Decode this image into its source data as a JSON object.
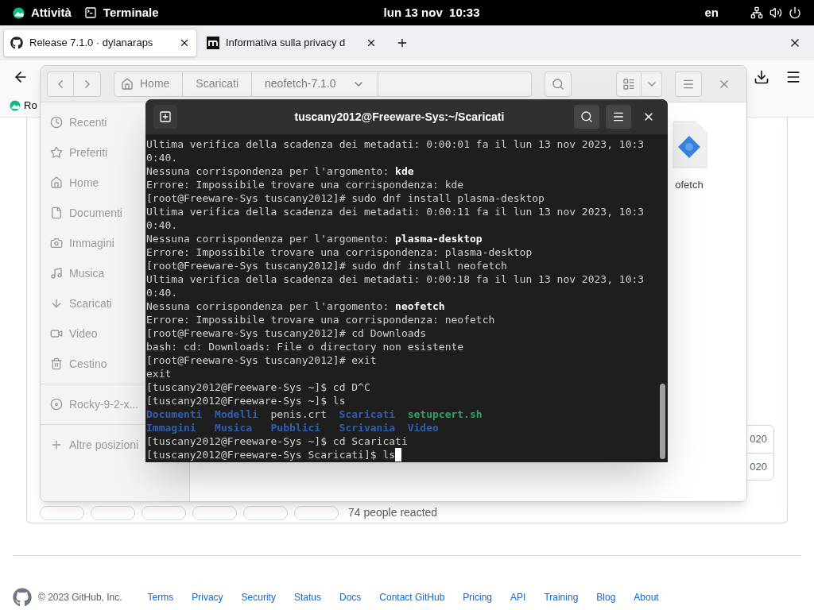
{
  "top_bar": {
    "activities": "Attività",
    "app": "Terminale",
    "clock": "lun 13 nov  10:33",
    "keyboard": "en"
  },
  "browser": {
    "tabs": [
      {
        "title": "Release 7.1.0 · dylanaraps",
        "selected": true
      },
      {
        "title": "Informativa sulla privacy d",
        "selected": false
      }
    ],
    "bookmarks": [
      "Ro"
    ],
    "page": {
      "dates": [
        "020",
        "020"
      ],
      "reactions_summary": "74 people reacted",
      "footer": {
        "copyright": "© 2023 GitHub, Inc.",
        "links": [
          "Terms",
          "Privacy",
          "Security",
          "Status",
          "Docs",
          "Contact GitHub",
          "Pricing",
          "API",
          "Training",
          "Blog",
          "About"
        ]
      }
    }
  },
  "files": {
    "path": [
      {
        "label": "Home",
        "selected": false
      },
      {
        "label": "Scaricati",
        "selected": false
      },
      {
        "label": "neofetch-7.1.0",
        "selected": true
      }
    ],
    "sidebar": [
      "Recenti",
      "Preferiti",
      "Home",
      "Documenti",
      "Immagini",
      "Musica",
      "Scaricati",
      "Video",
      "Cestino"
    ],
    "devices": [
      "Rocky-9-2-x..."
    ],
    "other_locations": "Altre posizioni",
    "items": [
      {
        "name": "ofetch"
      }
    ]
  },
  "terminal": {
    "title": "tuscany2012@Freeware-Sys:~/Scaricati",
    "lines": [
      {
        "kind": "text",
        "text": "Ultima verifica della scadenza dei metadati: 0:00:01 fa il lun 13 nov 2023, 10:3"
      },
      {
        "kind": "text",
        "text": "0:40."
      },
      {
        "kind": "text",
        "text": "Nessuna corrispondenza per l'argomento: **kde**"
      },
      {
        "kind": "text",
        "text": "Errore: Impossibile trovare una corrispondenza: kde"
      },
      {
        "kind": "text",
        "text": "[root@Freeware-Sys tuscany2012]# sudo dnf install plasma-desktop"
      },
      {
        "kind": "text",
        "text": "Ultima verifica della scadenza dei metadati: 0:00:11 fa il lun 13 nov 2023, 10:3"
      },
      {
        "kind": "text",
        "text": "0:40."
      },
      {
        "kind": "text",
        "text": "Nessuna corrispondenza per l'argomento: **plasma-desktop**"
      },
      {
        "kind": "text",
        "text": "Errore: Impossibile trovare una corrispondenza: plasma-desktop"
      },
      {
        "kind": "text",
        "text": "[root@Freeware-Sys tuscany2012]# sudo dnf install neofetch"
      },
      {
        "kind": "text",
        "text": "Ultima verifica della scadenza dei metadati: 0:00:18 fa il lun 13 nov 2023, 10:3"
      },
      {
        "kind": "text",
        "text": "0:40."
      },
      {
        "kind": "text",
        "text": "Nessuna corrispondenza per l'argomento: **neofetch**"
      },
      {
        "kind": "text",
        "text": "Errore: Impossibile trovare una corrispondenza: neofetch"
      },
      {
        "kind": "text",
        "text": "[root@Freeware-Sys tuscany2012]# cd Downloads"
      },
      {
        "kind": "text",
        "text": "bash: cd: Downloads: File o directory non esistente"
      },
      {
        "kind": "text",
        "text": "[root@Freeware-Sys tuscany2012]# exit"
      },
      {
        "kind": "text",
        "text": "exit"
      },
      {
        "kind": "text",
        "text": "[tuscany2012@Freeware-Sys ~]$ cd D^C"
      },
      {
        "kind": "text",
        "text": "[tuscany2012@Freeware-Sys ~]$ ls"
      },
      {
        "kind": "listing",
        "entries": [
          {
            "name": "Documenti",
            "kind": "dir"
          },
          {
            "name": "Modelli",
            "kind": "dir"
          },
          {
            "name": "penis.crt",
            "kind": "file"
          },
          {
            "name": "Scaricati",
            "kind": "dir"
          },
          {
            "name": "setupcert.sh",
            "kind": "exec"
          }
        ]
      },
      {
        "kind": "listing",
        "entries": [
          {
            "name": "Immagini",
            "kind": "dir"
          },
          {
            "name": "Musica",
            "kind": "dir"
          },
          {
            "name": "Pubblici",
            "kind": "dir"
          },
          {
            "name": "Scrivania",
            "kind": "dir"
          },
          {
            "name": "Video",
            "kind": "dir"
          }
        ]
      },
      {
        "kind": "text",
        "text": "[tuscany2012@Freeware-Sys ~]$ cd Scaricati"
      },
      {
        "kind": "text",
        "text": "[tuscany2012@Freeware-Sys Scaricati]$ ls"
      }
    ],
    "cursor": true
  }
}
